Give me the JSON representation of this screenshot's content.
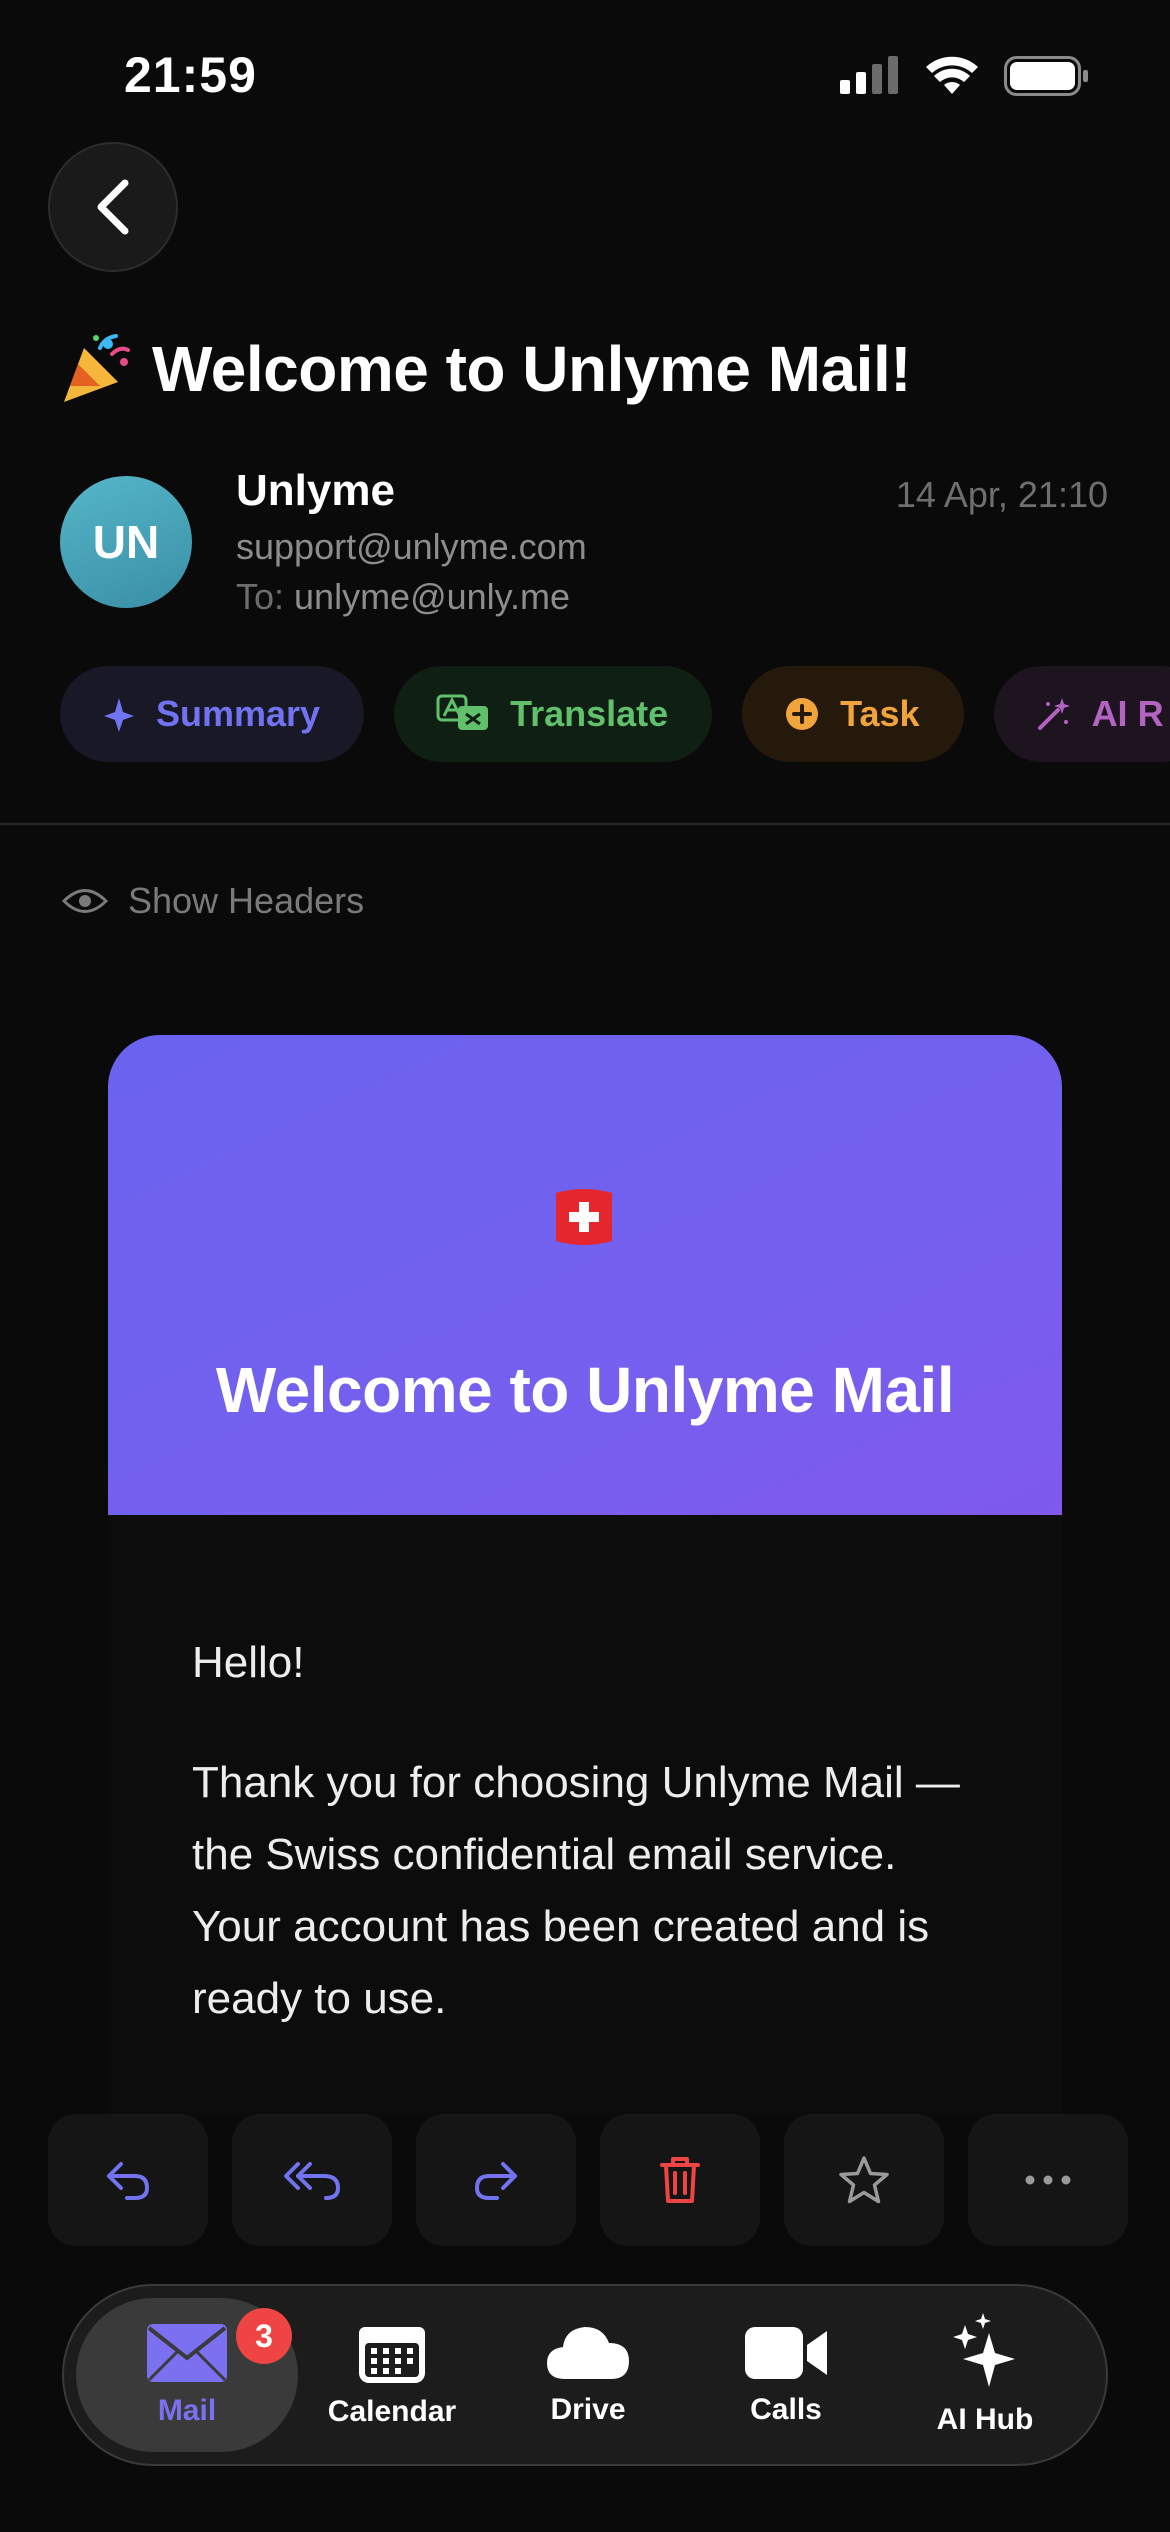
{
  "status_bar": {
    "time": "21:59"
  },
  "email": {
    "subject": "Welcome to Unlyme Mail!",
    "sender": {
      "initials": "UN",
      "name": "Unlyme",
      "email": "support@unlyme.com",
      "to_label": "To:",
      "to": "unlyme@unly.me"
    },
    "date": "14 Apr, 21:10"
  },
  "chips": [
    {
      "label": "Summary",
      "color": "#7173f0"
    },
    {
      "label": "Translate",
      "color": "#61c06b"
    },
    {
      "label": "Task",
      "color": "#f1a33c"
    },
    {
      "label": "AI R",
      "color": "#b364c2"
    }
  ],
  "show_headers": "Show Headers",
  "body": {
    "hero_title": "Welcome to Unlyme Mail",
    "greeting": "Hello!",
    "paragraph": "Thank you for choosing Unlyme Mail — the Swiss confidential email service. Your account has been created and is ready to use."
  },
  "actions": [
    "reply",
    "reply-all",
    "forward",
    "delete",
    "star",
    "more"
  ],
  "tab_bar": {
    "tabs": [
      {
        "label": "Mail",
        "badge": "3",
        "active": true
      },
      {
        "label": "Calendar"
      },
      {
        "label": "Drive"
      },
      {
        "label": "Calls"
      },
      {
        "label": "AI Hub"
      }
    ]
  },
  "colors": {
    "accent": "#7b70f0",
    "danger": "#ef4444",
    "background": "#0a0a0a"
  }
}
